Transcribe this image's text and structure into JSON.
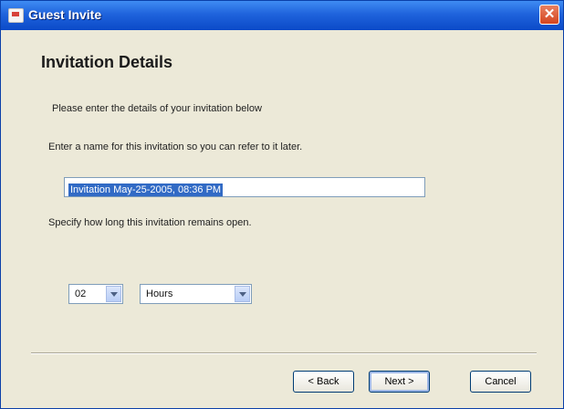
{
  "window": {
    "title": "Guest Invite",
    "close": "✕"
  },
  "page": {
    "heading": "Invitation Details",
    "instruction": "Please enter the details of your invitation below",
    "name_prompt": "Enter a name for this invitation so you can refer to it later.",
    "name_value": "Invitation May-25-2005, 08:36 PM",
    "duration_prompt": "Specify how long this invitation remains open.",
    "duration_value": "02",
    "duration_unit": "Hours"
  },
  "buttons": {
    "back": "< Back",
    "next": "Next >",
    "cancel": "Cancel"
  }
}
